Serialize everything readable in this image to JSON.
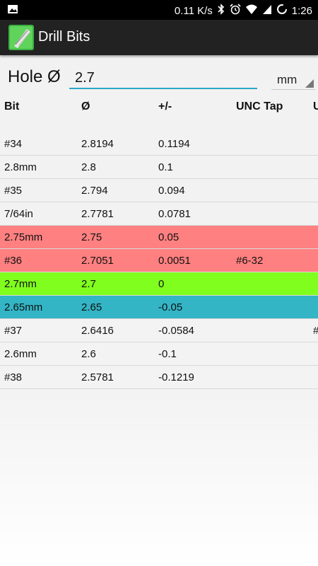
{
  "status_bar": {
    "speed": "0.11 K/s",
    "time": "1:26",
    "icons": [
      "image-icon",
      "bluetooth-icon",
      "alarm-icon",
      "wifi-icon",
      "signal-icon",
      "battery-icon"
    ]
  },
  "app": {
    "title": "Drill Bits",
    "logo": "drill-bit-logo"
  },
  "hole": {
    "label": "Hole Ø",
    "value": "2.7",
    "unit": "mm"
  },
  "table": {
    "headers": [
      "Bit",
      "Ø",
      "+/-",
      "UNC Tap",
      "U"
    ],
    "rows": [
      {
        "cells": [
          "#34",
          "2.8194",
          "0.1194",
          "",
          ""
        ],
        "color": ""
      },
      {
        "cells": [
          "2.8mm",
          "2.8",
          "0.1",
          "",
          ""
        ],
        "color": ""
      },
      {
        "cells": [
          "#35",
          "2.794",
          "0.094",
          "",
          ""
        ],
        "color": ""
      },
      {
        "cells": [
          "7/64in",
          "2.7781",
          "0.0781",
          "",
          ""
        ],
        "color": ""
      },
      {
        "cells": [
          "2.75mm",
          "2.75",
          "0.05",
          "",
          ""
        ],
        "color": "#ff8080"
      },
      {
        "cells": [
          "#36",
          "2.7051",
          "0.0051",
          "#6-32",
          ""
        ],
        "color": "#ff8080"
      },
      {
        "cells": [
          "2.7mm",
          "2.7",
          "0",
          "",
          ""
        ],
        "color": "#80ff1f"
      },
      {
        "cells": [
          "2.65mm",
          "2.65",
          "-0.05",
          "",
          ""
        ],
        "color": "#33b5c5"
      },
      {
        "cells": [
          "#37",
          "2.6416",
          "-0.0584",
          "",
          "#"
        ],
        "color": ""
      },
      {
        "cells": [
          "2.6mm",
          "2.6",
          "-0.1",
          "",
          ""
        ],
        "color": ""
      },
      {
        "cells": [
          "#38",
          "2.5781",
          "-0.1219",
          "",
          ""
        ],
        "color": ""
      }
    ]
  },
  "colors": {
    "accent": "#29a8c8",
    "appbar": "#222222"
  }
}
